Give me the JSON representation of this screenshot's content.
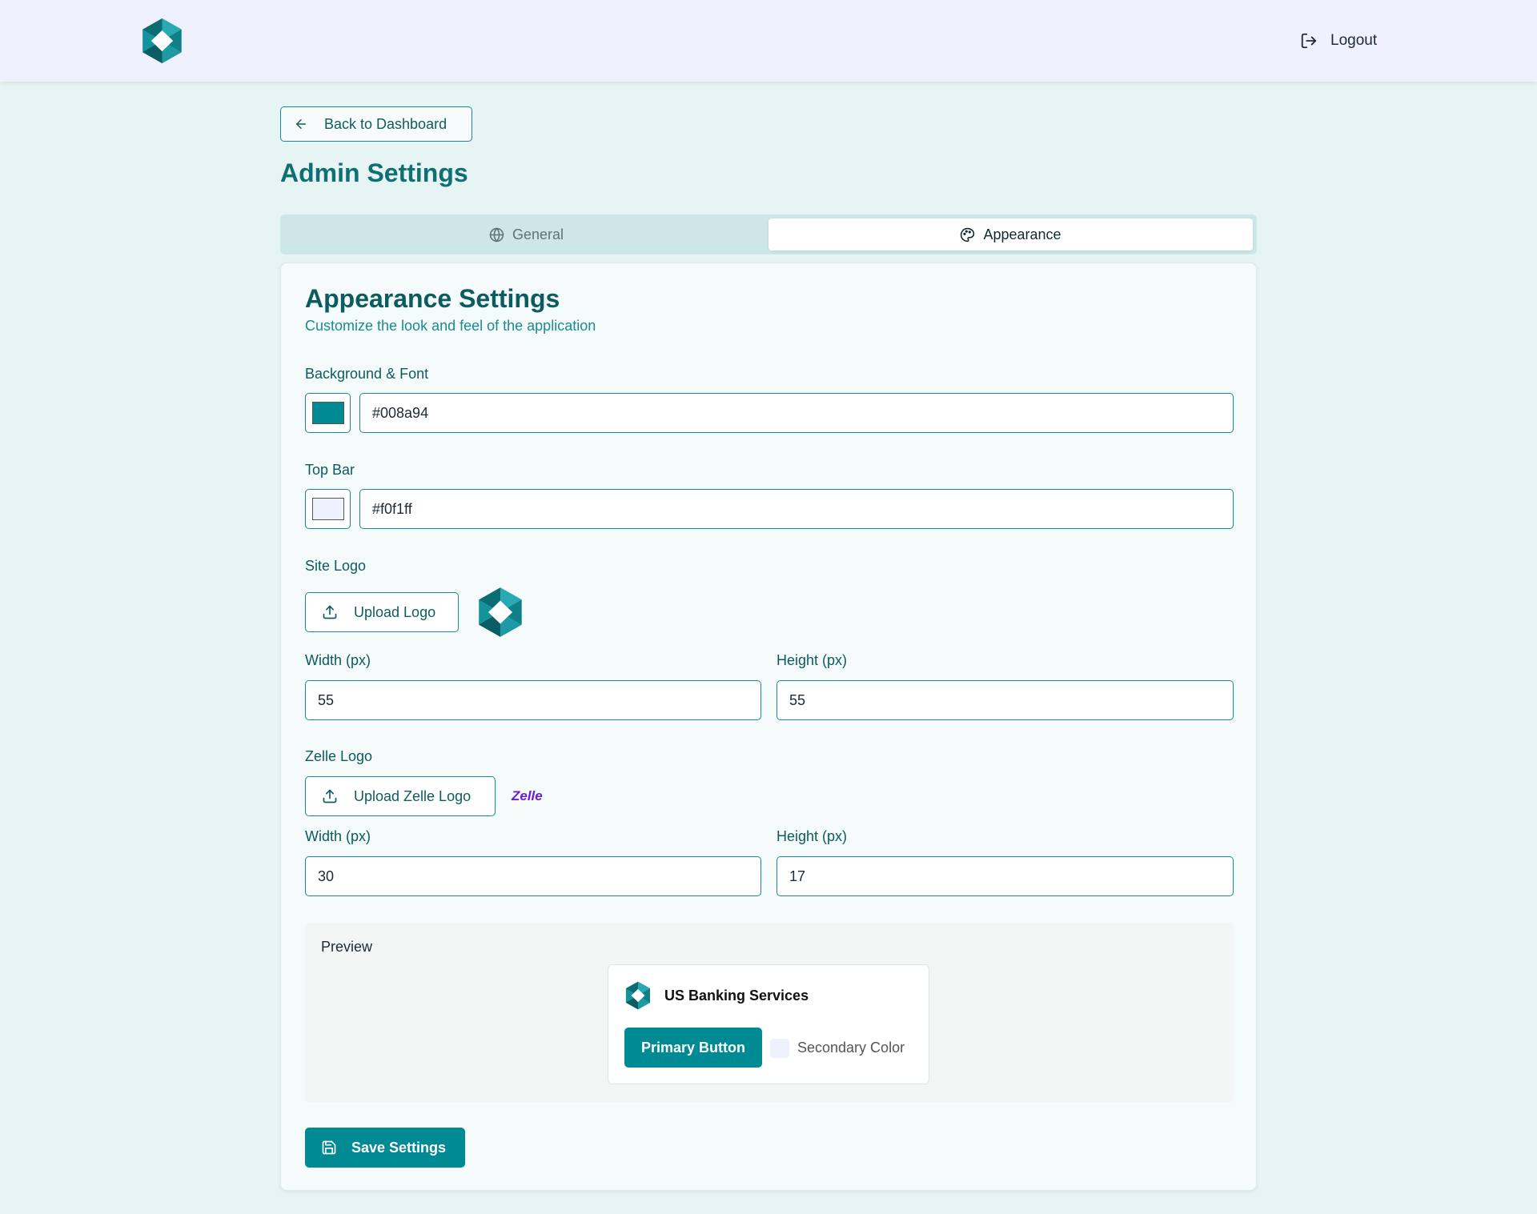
{
  "header": {
    "logout_label": "Logout",
    "logo_icon": "hexagon-diamond-logo",
    "background_color": "#f0f1ff"
  },
  "nav": {
    "back_label": "Back to Dashboard"
  },
  "page": {
    "title": "Admin Settings",
    "background_color": "#e6f4f4"
  },
  "tabs": [
    {
      "label": "General",
      "icon": "globe-icon",
      "active": false
    },
    {
      "label": "Appearance",
      "icon": "palette-icon",
      "active": true
    }
  ],
  "appearance": {
    "title": "Appearance Settings",
    "subtitle": "Customize the look and feel of the application",
    "background_font": {
      "label": "Background & Font",
      "color": "#008a94",
      "value": "#008a94"
    },
    "top_bar": {
      "label": "Top Bar",
      "color": "#f0f1ff",
      "value": "#f0f1ff"
    },
    "site_logo": {
      "label": "Site Logo",
      "upload_label": "Upload Logo",
      "width_label": "Width (px)",
      "height_label": "Height (px)",
      "width": "55",
      "height": "55"
    },
    "zelle_logo": {
      "label": "Zelle Logo",
      "upload_label": "Upload Zelle Logo",
      "preview_text": "Zelle",
      "width_label": "Width (px)",
      "height_label": "Height (px)",
      "width": "30",
      "height": "17"
    },
    "preview": {
      "label": "Preview",
      "site_name": "US Banking Services",
      "primary_button": "Primary Button",
      "secondary_label": "Secondary Color"
    },
    "save_label": "Save Settings"
  },
  "colors": {
    "primary": "#008a94",
    "accent_text": "#0f6f73",
    "zelle_purple": "#6d1ed4"
  }
}
